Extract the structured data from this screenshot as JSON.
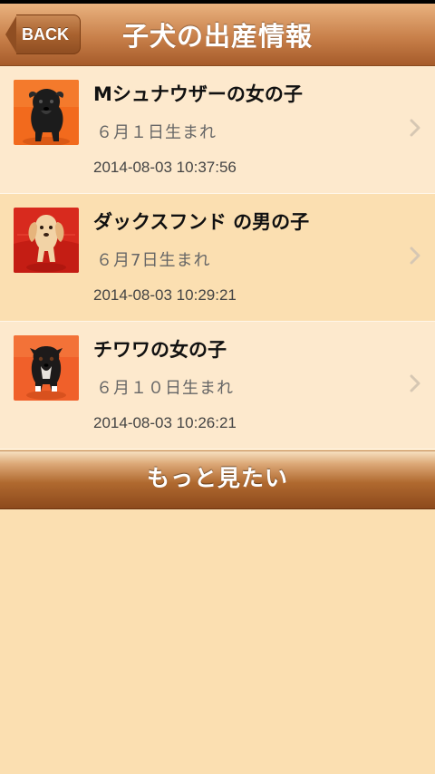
{
  "header": {
    "back_label": "BACK",
    "title": "子犬の出産情報"
  },
  "puppies": [
    {
      "title": "Mシュナウザーの女の子",
      "birth": "６月１日生まれ",
      "date": "2014-08-03 10:37:56",
      "image": "black-schnauzer-puppy-photo"
    },
    {
      "title": "ダックスフンド の男の子",
      "birth": "６月7日生まれ",
      "date": "2014-08-03 10:29:21",
      "image": "cream-dachshund-puppy-photo"
    },
    {
      "title": "チワワの女の子",
      "birth": "６月１０日生まれ",
      "date": "2014-08-03 10:26:21",
      "image": "black-tan-chihuahua-puppy-photo"
    }
  ],
  "more_button": {
    "label": "もっと見たい"
  },
  "icons": {
    "back": "back-arrow-icon",
    "disclosure": "chevron-right-icon"
  },
  "colors": {
    "nav_top": "#e9b27f",
    "nav_bottom": "#a65b2a",
    "background": "#fbdfb1",
    "row_light": "#fde9cd",
    "button_dark": "#8d4a1c"
  }
}
